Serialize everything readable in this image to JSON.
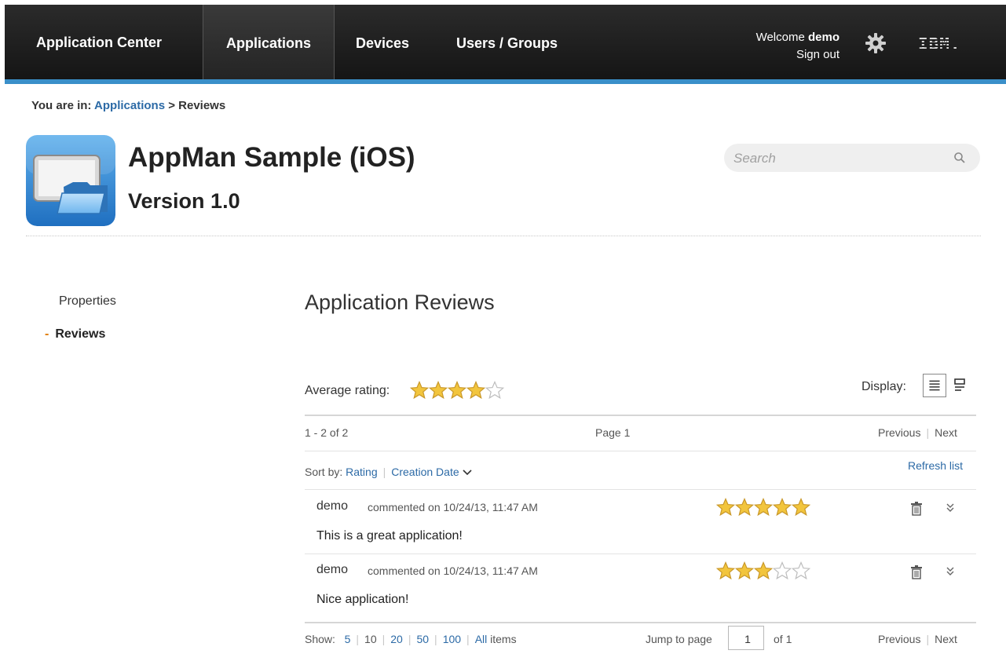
{
  "topbar": {
    "brand": "Application Center",
    "tabs": [
      "Applications",
      "Devices",
      "Users / Groups"
    ],
    "welcome_prefix": "Welcome",
    "username": "demo",
    "sign_out": "Sign out",
    "logo_text": "IBM.",
    "accent_color": "#3a8fc9"
  },
  "breadcrumb": {
    "prefix": "You are in:",
    "link": "Applications",
    "separator": ">",
    "current": "Reviews"
  },
  "app": {
    "title": "AppMan Sample (iOS)",
    "version": "Version 1.0",
    "icon": "tablet-folder-icon"
  },
  "search": {
    "placeholder": "Search",
    "value": ""
  },
  "sidebar": {
    "items": [
      "Properties",
      "Reviews"
    ],
    "active": "Reviews",
    "active_marker": "-"
  },
  "reviews": {
    "heading": "Application Reviews",
    "average_label": "Average rating:",
    "average_rating": 4,
    "max_rating": 5,
    "display_label": "Display:",
    "range": "1 - 2 of 2",
    "page": "Page 1",
    "previous": "Previous",
    "next": "Next",
    "sort_label": "Sort by:",
    "sort_rating": "Rating",
    "sort_date": "Creation Date",
    "refresh": "Refresh list",
    "items": [
      {
        "user": "demo",
        "meta": "commented on 10/24/13, 11:47 AM",
        "text": "This is a great application!",
        "rating": 5
      },
      {
        "user": "demo",
        "meta": "commented on 10/24/13, 11:47 AM",
        "text": "Nice application!",
        "rating": 3
      }
    ],
    "footer": {
      "show_label": "Show:",
      "page_sizes": [
        "5",
        "10",
        "20",
        "50",
        "100"
      ],
      "all_items_link": "All",
      "all_items_suffix": "items",
      "jump_label": "Jump to page",
      "jump_value": "1",
      "of_pages": "of 1"
    }
  }
}
